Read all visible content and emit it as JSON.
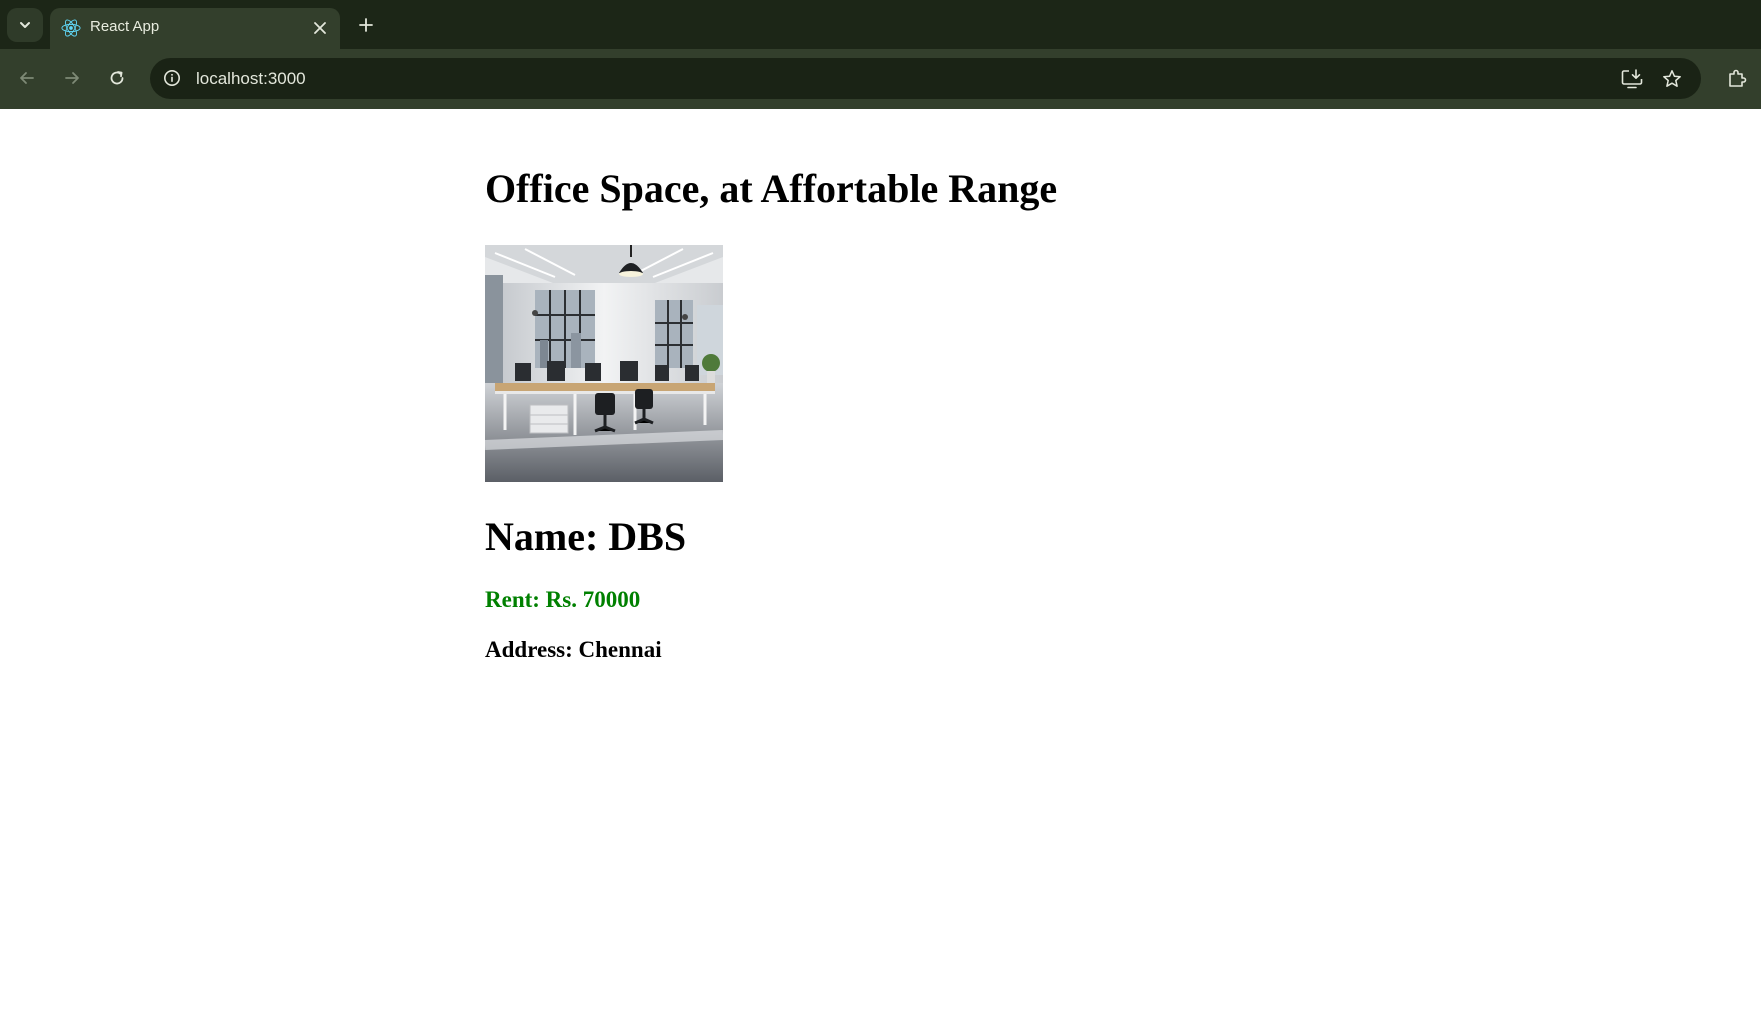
{
  "browser": {
    "tab": {
      "title": "React App",
      "favicon": "react-logo-icon"
    },
    "address_bar": {
      "url": "localhost:3000"
    },
    "icons": {
      "tab_search": "chevron-down-icon",
      "tab_close": "close-icon",
      "new_tab": "plus-icon",
      "back": "arrow-left-icon",
      "forward": "arrow-right-icon",
      "reload": "reload-icon",
      "site_info": "info-icon",
      "install": "install-app-icon",
      "bookmark": "star-icon",
      "extensions": "puzzle-icon"
    },
    "colors": {
      "tabstrip": "#1c2617",
      "toolbar": "#333f2c",
      "omnibox": "#1a2315"
    }
  },
  "page": {
    "heading": "Office Space, at Affortable Range",
    "office": {
      "name_text": "Name: DBS",
      "rent_text": "Rent: Rs. 70000",
      "address_text": "Address: Chennai",
      "rent_color": "#008000",
      "address_color": "#000000"
    }
  }
}
